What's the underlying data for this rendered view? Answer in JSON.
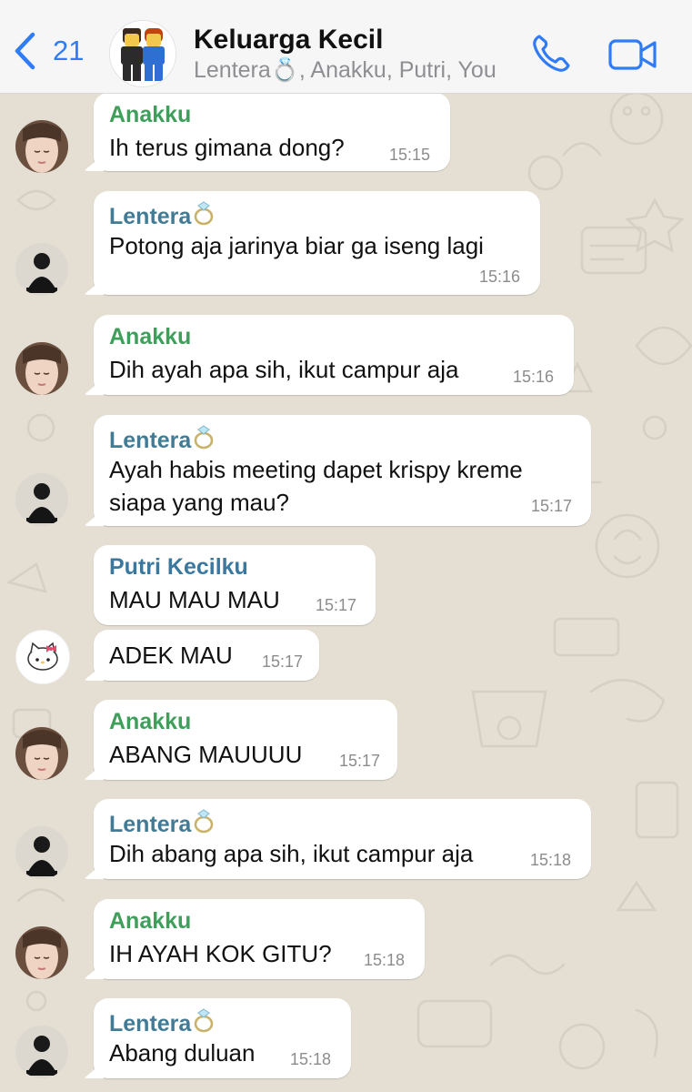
{
  "header": {
    "back_count": "21",
    "title": "Keluarga Kecil",
    "subtitle": "Lentera💍, Anakku, Putri, You"
  },
  "messages": [
    {
      "sender": "Anakku",
      "text": "Ih terus gimana dong?",
      "time": "15:15"
    },
    {
      "sender": "Lentera💍",
      "text": "Potong aja jarinya biar ga iseng lagi",
      "time": "15:16"
    },
    {
      "sender": "Anakku",
      "text": "Dih ayah apa sih, ikut campur aja",
      "time": "15:16"
    },
    {
      "sender": "Lentera💍",
      "text_line1": "Ayah habis meeting dapet krispy kreme",
      "text_line2": "siapa yang mau?",
      "time": "15:17"
    },
    {
      "sender": "Putri Kecilku",
      "text": "MAU MAU MAU",
      "time": "15:17"
    },
    {
      "text": "ADEK MAU",
      "time": "15:17"
    },
    {
      "sender": "Anakku",
      "text": "ABANG MAUUUU",
      "time": "15:17"
    },
    {
      "sender": "Lentera💍",
      "text": "Dih abang apa sih, ikut campur aja",
      "time": "15:18"
    },
    {
      "sender": "Anakku",
      "text": "IH AYAH KOK GITU?",
      "time": "15:18"
    },
    {
      "sender": "Lentera💍",
      "text": "Abang duluan",
      "time": "15:18"
    }
  ],
  "colors": {
    "accent": "#2f7cf6",
    "anakku_name": "#3e9f5b",
    "lentera_name": "#417b95",
    "putri_name": "#3b78a0",
    "wallpaper": "#e4ded3"
  },
  "icons": [
    "chevron-left-icon",
    "phone-icon",
    "video-camera-icon",
    "ring-icon",
    "hello-kitty-icon"
  ]
}
